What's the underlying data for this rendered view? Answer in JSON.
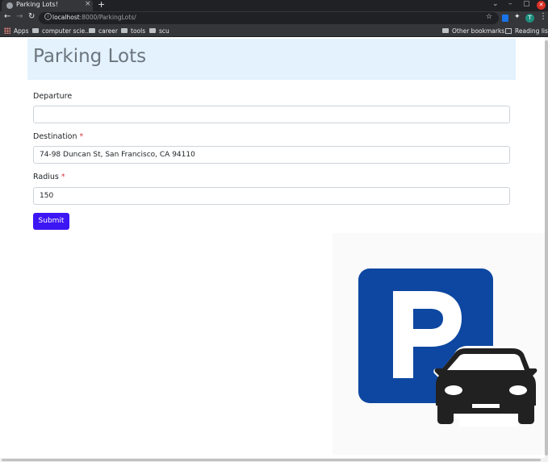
{
  "browser": {
    "tab_title": "Parking Lots!",
    "tab_close": "×",
    "new_tab": "+",
    "url_host": "localhost",
    "url_path": ":8000/ParkingLots/",
    "avatar_letter": "T",
    "window_controls": {
      "minimize": "–",
      "maximize": "▢",
      "close": "✕"
    },
    "bookmarks": [
      {
        "label": "Apps",
        "icon": "apps-grid-icon"
      },
      {
        "label": "computer scie...",
        "icon": "folder-icon"
      },
      {
        "label": "career",
        "icon": "folder-icon"
      },
      {
        "label": "tools",
        "icon": "folder-icon"
      },
      {
        "label": "scu",
        "icon": "folder-icon"
      }
    ],
    "other_bookmarks": "Other bookmarks",
    "reading_list": "Reading list"
  },
  "page": {
    "title": "Parking Lots",
    "form": {
      "departure": {
        "label": "Departure",
        "value": "",
        "required": false
      },
      "destination": {
        "label": "Destination",
        "value": "74-98 Duncan St, San Francisco, CA 94110",
        "required": true
      },
      "radius": {
        "label": "Radius",
        "value": "150",
        "required": true
      },
      "required_marker": "*",
      "submit_label": "Submit"
    },
    "illustration": {
      "icon": "parking-car-icon",
      "sign_letter": "P",
      "sign_color": "#0d47a1",
      "car_color": "#212121"
    }
  },
  "colors": {
    "header_bg": "#e3f2fd",
    "title_color": "#6c757d",
    "submit_bg": "#3d16f4",
    "required": "#dc3545"
  }
}
